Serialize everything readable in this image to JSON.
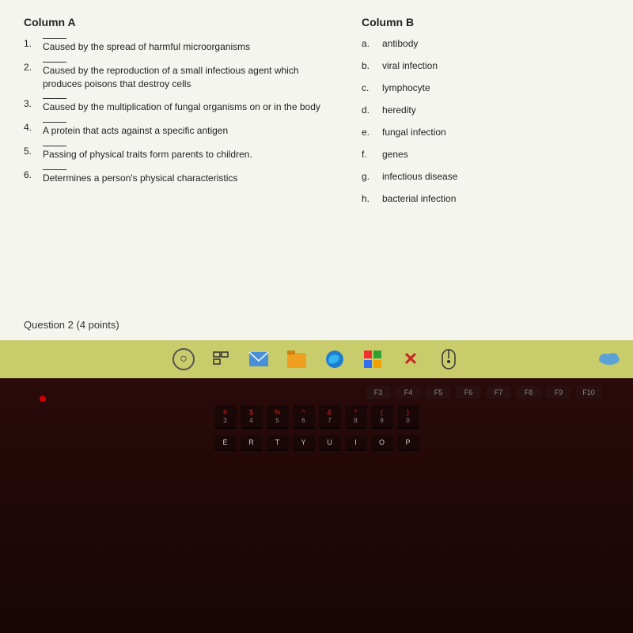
{
  "columns": {
    "col_a_header": "Column A",
    "col_b_header": "Column B",
    "col_a_items": [
      {
        "number": "1.",
        "text": "Caused by the spread of harmful microorganisms"
      },
      {
        "number": "2.",
        "text": "Caused by the reproduction of a small infectious agent which produces poisons that destroy cells"
      },
      {
        "number": "3.",
        "text": "Caused by the multiplication of fungal organisms on or in the body"
      },
      {
        "number": "4.",
        "text": "A protein that acts against a specific antigen"
      },
      {
        "number": "5.",
        "text": "Passing of physical traits form parents to children."
      },
      {
        "number": "6.",
        "text": "Determines a person's physical characteristics"
      }
    ],
    "col_b_items": [
      {
        "letter": "a.",
        "text": "antibody"
      },
      {
        "letter": "b.",
        "text": "viral infection"
      },
      {
        "letter": "c.",
        "text": "lymphocyte"
      },
      {
        "letter": "d.",
        "text": "heredity"
      },
      {
        "letter": "e.",
        "text": "fungal infection"
      },
      {
        "letter": "f.",
        "text": "genes"
      },
      {
        "letter": "g.",
        "text": "infectious disease"
      },
      {
        "letter": "h.",
        "text": "bacterial infection"
      }
    ]
  },
  "question_label": "Question 2 (4 points)",
  "taskbar": {
    "icons": [
      "search",
      "taskbar",
      "mail",
      "files",
      "edge",
      "store",
      "x",
      "mouse"
    ]
  },
  "keyboard": {
    "fn_keys": [
      "F3",
      "F4",
      "F5",
      "F6",
      "F7",
      "F8",
      "F9",
      "F10"
    ],
    "row1": [
      "#",
      "$",
      "%",
      "^",
      "&",
      "*",
      "(",
      ")"
    ],
    "row2": [
      "3",
      "4",
      "5",
      "6",
      "7",
      "8",
      "9"
    ],
    "row3": [
      "E",
      "R",
      "T",
      "Y",
      "U",
      "I",
      "O"
    ]
  }
}
